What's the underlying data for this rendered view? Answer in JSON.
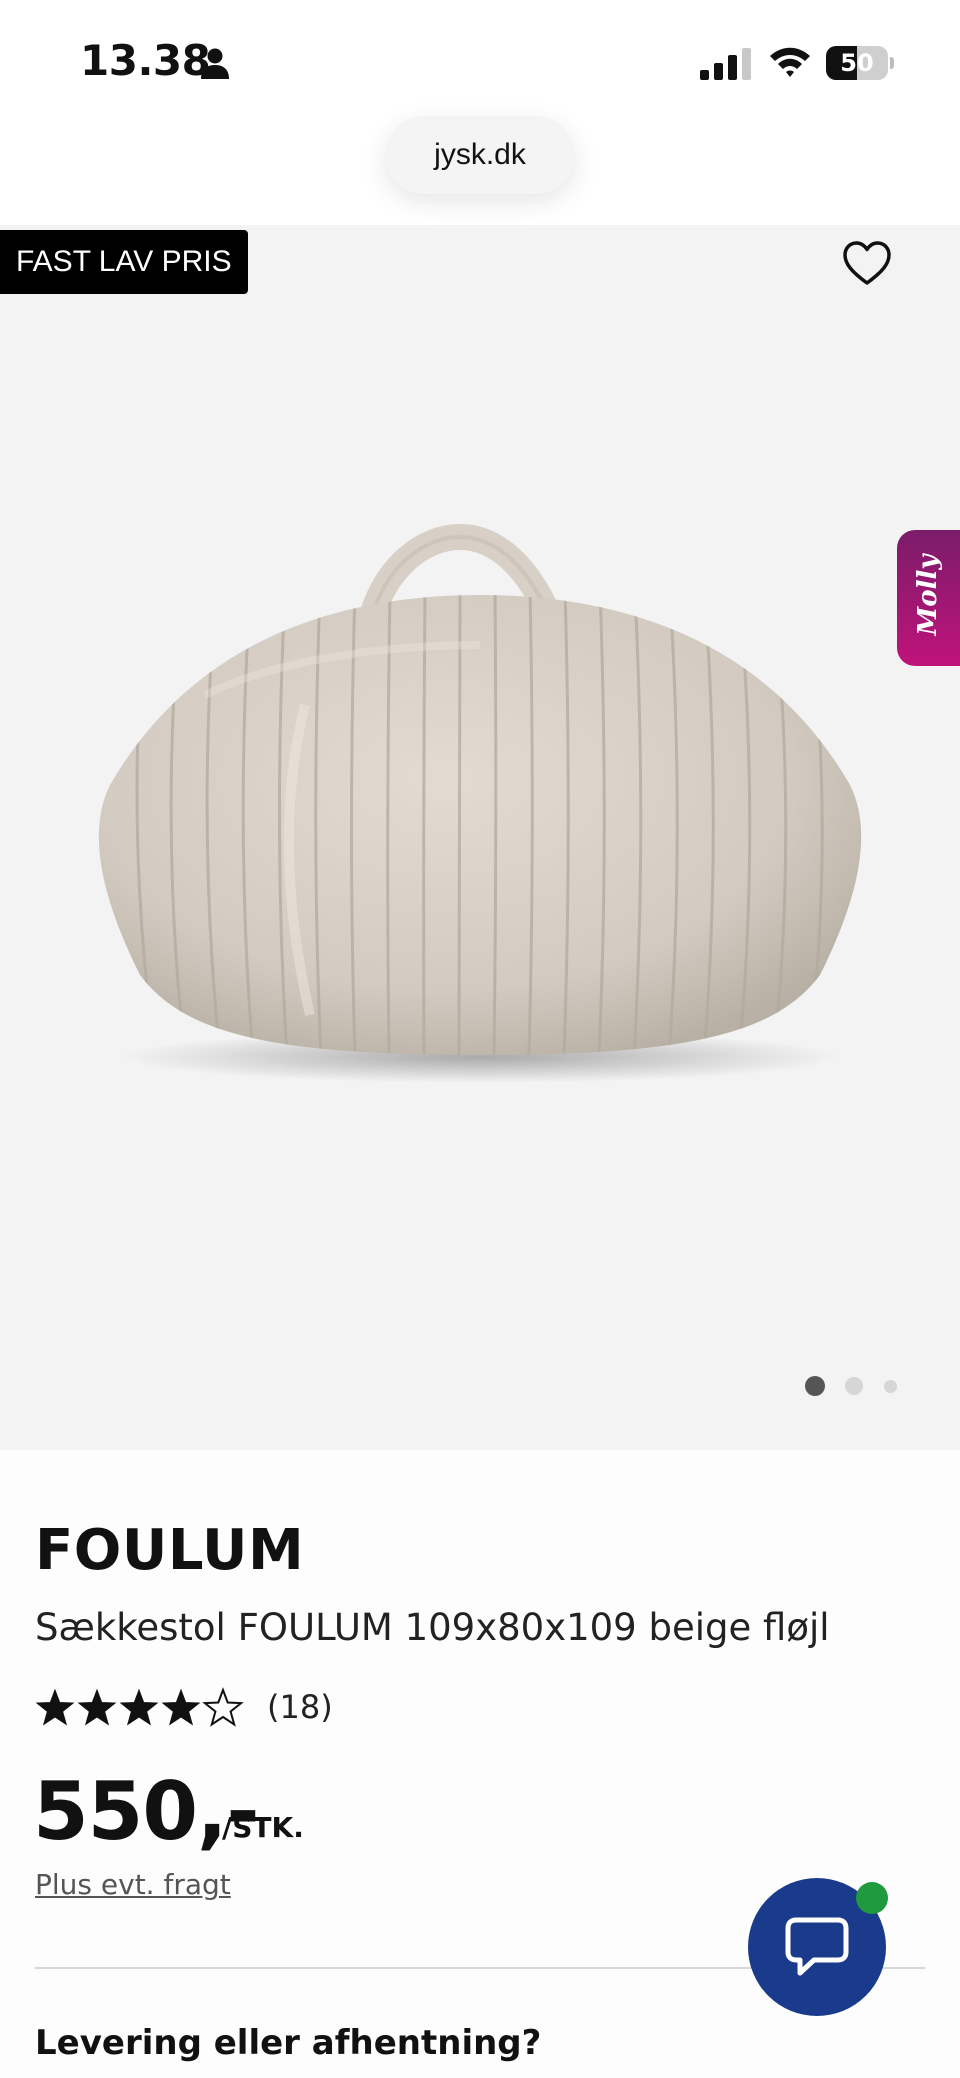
{
  "status_bar": {
    "time": "13.38",
    "battery_level": "50",
    "battery_fraction": 0.5
  },
  "browser": {
    "url": "jysk.dk"
  },
  "product_image": {
    "badge": "FAST LAV PRIS",
    "assistant_tab": "Molly",
    "carousel": {
      "total": 3,
      "active_index": 0
    }
  },
  "product": {
    "brand": "FOULUM",
    "name": "Sækkestol FOULUM 109x80x109 beige fløjl",
    "rating": {
      "stars": 4,
      "max_stars": 5,
      "review_count": "(18)"
    },
    "price": "550,-",
    "price_unit": "/STK.",
    "shipping_note": "Plus evt. fragt"
  },
  "delivery": {
    "heading": "Levering eller afhentning?"
  },
  "chat": {
    "online": true
  },
  "colors": {
    "chat_button": "#1a3a8c",
    "online_dot": "#1f9a3e",
    "molly_gradient_top": "#7a1c6a",
    "molly_gradient_bottom": "#c0137a",
    "badge_background": "#000000",
    "image_background": "#f3f3f3"
  },
  "icons": {
    "status": [
      "person-icon",
      "signal-icon",
      "wifi-icon",
      "battery-icon"
    ],
    "favorite": "heart-icon",
    "chat": "chat-bubble-icon",
    "rating": "star-icon"
  }
}
